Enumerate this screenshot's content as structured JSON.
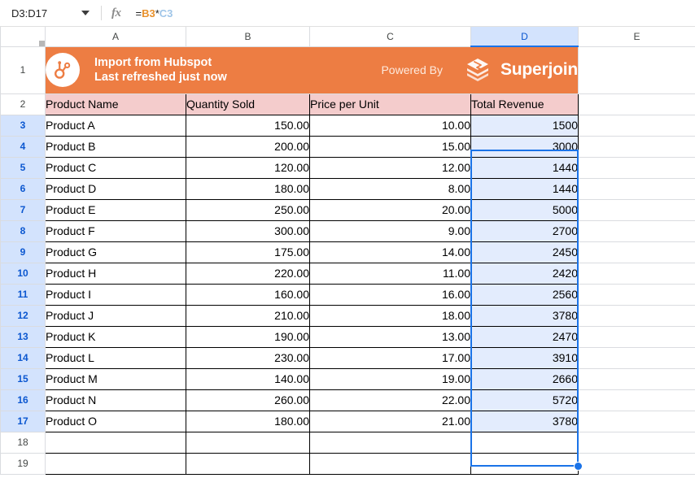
{
  "formula_bar": {
    "name_box_value": "D3:D17",
    "fx_label": "fx",
    "formula_prefix": "=",
    "formula_ref_1": "B3",
    "formula_operator": "*",
    "formula_ref_2": "C3",
    "formula_full": "=B3*C3"
  },
  "column_headers": [
    "A",
    "B",
    "C",
    "D",
    "E"
  ],
  "selected_column": "D",
  "row_headers": [
    "1",
    "2",
    "3",
    "4",
    "5",
    "6",
    "7",
    "8",
    "9",
    "10",
    "11",
    "12",
    "13",
    "14",
    "15",
    "16",
    "17",
    "18",
    "19"
  ],
  "banner": {
    "title_line_1": "Import from Hubspot",
    "title_line_2": "Last refreshed just now",
    "powered_by": "Powered By",
    "brand_name": "Superjoin",
    "background_color": "#ED7D43",
    "hubspot_icon": "hubspot-sprocket-icon",
    "superjoin_icon": "superjoin-layers-icon"
  },
  "table": {
    "header_background": "#F4CCCC",
    "headers": [
      "Product Name",
      "Quantity Sold",
      "Price per Unit",
      "Total Revenue"
    ],
    "rows": [
      {
        "row": "3",
        "product": "Product A",
        "quantity": "150.00",
        "price": "10.00",
        "revenue": "1500"
      },
      {
        "row": "4",
        "product": "Product B",
        "quantity": "200.00",
        "price": "15.00",
        "revenue": "3000"
      },
      {
        "row": "5",
        "product": "Product C",
        "quantity": "120.00",
        "price": "12.00",
        "revenue": "1440"
      },
      {
        "row": "6",
        "product": "Product D",
        "quantity": "180.00",
        "price": "8.00",
        "revenue": "1440"
      },
      {
        "row": "7",
        "product": "Product E",
        "quantity": "250.00",
        "price": "20.00",
        "revenue": "5000"
      },
      {
        "row": "8",
        "product": "Product F",
        "quantity": "300.00",
        "price": "9.00",
        "revenue": "2700"
      },
      {
        "row": "9",
        "product": "Product G",
        "quantity": "175.00",
        "price": "14.00",
        "revenue": "2450"
      },
      {
        "row": "10",
        "product": "Product H",
        "quantity": "220.00",
        "price": "11.00",
        "revenue": "2420"
      },
      {
        "row": "11",
        "product": "Product I",
        "quantity": "160.00",
        "price": "16.00",
        "revenue": "2560"
      },
      {
        "row": "12",
        "product": "Product J",
        "quantity": "210.00",
        "price": "18.00",
        "revenue": "3780"
      },
      {
        "row": "13",
        "product": "Product K",
        "quantity": "190.00",
        "price": "13.00",
        "revenue": "2470"
      },
      {
        "row": "14",
        "product": "Product L",
        "quantity": "230.00",
        "price": "17.00",
        "revenue": "3910"
      },
      {
        "row": "15",
        "product": "Product M",
        "quantity": "140.00",
        "price": "19.00",
        "revenue": "2660"
      },
      {
        "row": "16",
        "product": "Product N",
        "quantity": "260.00",
        "price": "22.00",
        "revenue": "5720"
      },
      {
        "row": "17",
        "product": "Product O",
        "quantity": "180.00",
        "price": "21.00",
        "revenue": "3780"
      }
    ],
    "empty_rows": [
      "18",
      "19"
    ]
  },
  "colors": {
    "selection_fill": "#E3ECFD",
    "selection_border": "#1A73E8",
    "header_highlight": "#D3E3FD"
  }
}
